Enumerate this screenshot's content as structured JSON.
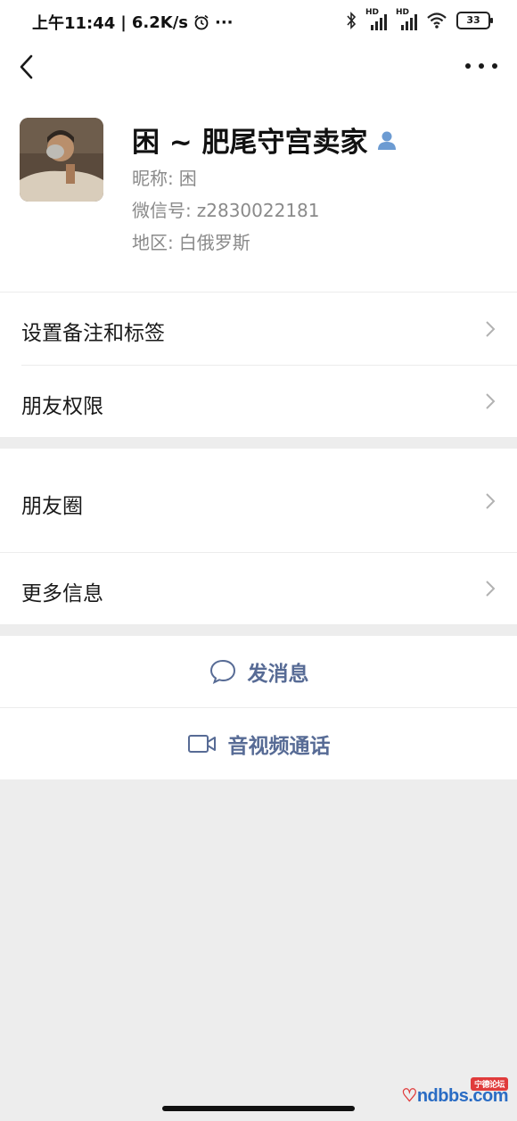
{
  "status_bar": {
    "time": "上午11:44",
    "speed": "6.2K/s",
    "more": "···",
    "signal1_tag": "HD",
    "signal2_tag": "HD",
    "battery": "33"
  },
  "nav": {
    "back_icon": "chevron-left-icon",
    "more_icon": "more-icon"
  },
  "profile": {
    "display_name": "困 ~ 肥尾守宫卖家",
    "nickname_label": "昵称:",
    "nickname": "困",
    "wechat_id_label": "微信号:",
    "wechat_id": "z2830022181",
    "region_label": "地区:",
    "region": "白俄罗斯"
  },
  "menu": {
    "remark_tags": "设置备注和标签",
    "friend_permissions": "朋友权限",
    "moments": "朋友圈",
    "more_info": "更多信息"
  },
  "actions": {
    "send_message": "发消息",
    "video_call": "音视频通话"
  },
  "watermark": {
    "text": "ndbbs.com",
    "tag": "宁德论坛"
  },
  "colors": {
    "link_blue": "#576b95",
    "background_gray": "#ededed",
    "contact_icon_blue": "#6c9bd2"
  }
}
